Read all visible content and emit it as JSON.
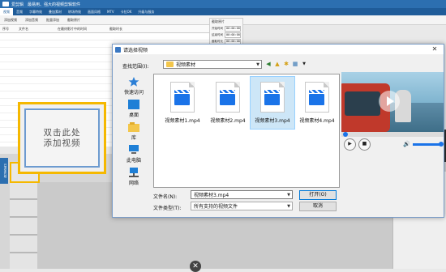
{
  "app": {
    "title": "爱剪辑　最易用、强大的视频剪辑软件",
    "tabs": [
      "视频",
      "音频",
      "字幕特效",
      "叠加素材",
      "转场特效",
      "画面风格",
      "MTV",
      "卡拉OK",
      "升级与服务"
    ],
    "toolbar": [
      "添加视频",
      "添加音频",
      "批量添加",
      "截取原片"
    ],
    "grid_columns": [
      "序号",
      "文件名",
      "在最终影片中的时间",
      "截取时长"
    ],
    "right_panel": {
      "title": "截取原片",
      "fields": [
        {
          "label": "开始时间",
          "value": "00:00:00.000"
        },
        {
          "label": "结束时间",
          "value": "00:00:00.000"
        },
        {
          "label": "截取时长",
          "value": "00:00:00.000"
        },
        {
          "label": "原片时长",
          "value": "00:00:00.000"
        }
      ]
    },
    "add_video_line1": "双击此处",
    "add_video_line2": "添加视频",
    "side_tab": "已添加片段"
  },
  "dialog": {
    "title": "请选择视频",
    "look_in_label": "查找范围(I):",
    "look_in_value": "视频素材",
    "places": [
      {
        "label": "快速访问",
        "icon": "star-icon"
      },
      {
        "label": "桌面",
        "icon": "desktop-icon"
      },
      {
        "label": "库",
        "icon": "library-icon"
      },
      {
        "label": "此电脑",
        "icon": "computer-icon"
      },
      {
        "label": "网络",
        "icon": "network-icon"
      }
    ],
    "files": [
      {
        "name": "视频素材1.mp4",
        "selected": false
      },
      {
        "name": "视频素材2.mp4",
        "selected": false
      },
      {
        "name": "视频素材3.mp4",
        "selected": true
      },
      {
        "name": "视频素材4.mp4",
        "selected": false
      }
    ],
    "file_name_label": "文件名(N):",
    "file_name_value": "视频素材3.mp4",
    "file_type_label": "文件类型(T):",
    "file_type_value": "所有支持的视频文件",
    "open_label": "打开(O)",
    "cancel_label": "取消",
    "close_glyph": "✕"
  },
  "colors": {
    "accent": "#2c6fb0",
    "highlight": "#f5b800",
    "selection": "#cde6f7"
  }
}
